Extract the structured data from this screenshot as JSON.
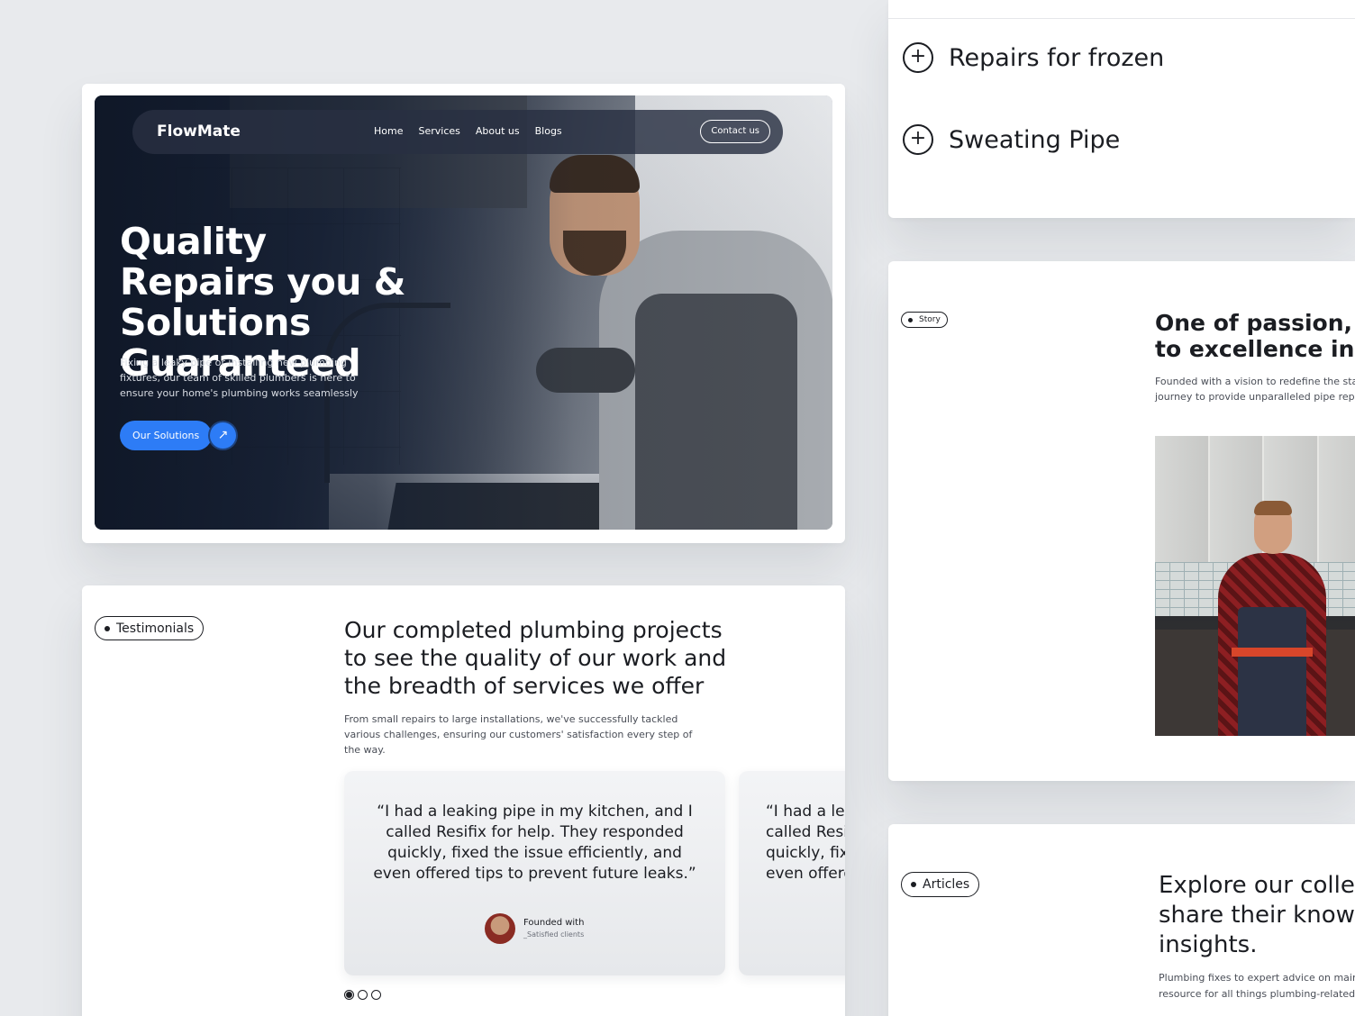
{
  "hero": {
    "brand": "FlowMate",
    "nav": [
      "Home",
      "Services",
      "About us",
      "Blogs"
    ],
    "contact_label": "Contact us",
    "title": "Quality Repairs you & Solutions Guaranteed",
    "description": "Fixing a leaky pipe or installing new plumbing fixtures, our team of skilled plumbers is here to ensure your home's plumbing works seamlessly",
    "cta_label": "Our Solutions",
    "cta_icon": "arrow-up-right-icon",
    "accent_color": "#2d7cf6"
  },
  "testimonials": {
    "pill": "Testimonials",
    "title": "Our completed plumbing projects to see the quality of our work and the breadth of services we offer",
    "description": "From small repairs to large installations, we've successfully tackled various challenges, ensuring our customers' satisfaction every step of the way.",
    "cards": [
      {
        "quote": "“I had a leaking pipe in my kitchen, and I called Resifix for help. They responded quickly, fixed the issue efficiently, and even offered tips to prevent future leaks.”",
        "name": "Founded with",
        "sub": "_Satisfied clients"
      },
      {
        "quote": "“I had a leaking pipe in my kitchen, and I called Resifix for help. They responded quickly, fixed the issue efficiently, and even offered tips to prevent future leaks.”"
      }
    ],
    "pagination": {
      "total": 3,
      "active": 1
    }
  },
  "faq": {
    "items": [
      {
        "label": "Repairs for frozen",
        "icon": "plus-circle-icon"
      },
      {
        "label": "Sweating Pipe",
        "icon": "plus-circle-icon"
      }
    ]
  },
  "story": {
    "pill": "Story",
    "title_line1": "One of passion, de",
    "title_line2": "to excellence in plu",
    "desc_line1": "Founded with a vision to redefine the stand",
    "desc_line2": "journey to provide unparalleled pipe repair"
  },
  "articles": {
    "pill": "Articles",
    "title": "Explore our collect\nshare their knowle\ninsights.",
    "description": "Plumbing fixes to expert advice on maint\nresource for all things plumbing-related."
  }
}
